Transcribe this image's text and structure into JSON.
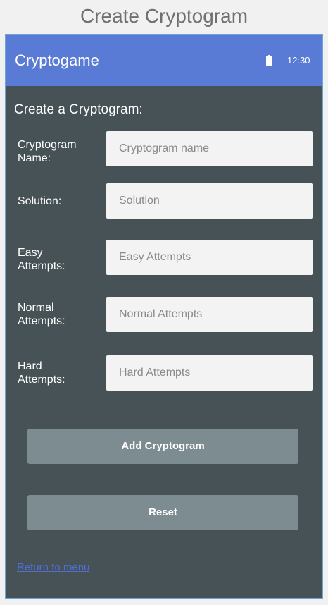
{
  "page": {
    "title": "Create Cryptogram"
  },
  "app_bar": {
    "title": "Cryptogame",
    "time": "12:30",
    "battery_icon": "battery-icon"
  },
  "form": {
    "heading": "Create a Cryptogram:",
    "fields": [
      {
        "label": "Cryptogram\nName:",
        "placeholder": "Cryptogram name",
        "value": ""
      },
      {
        "label": "Solution:",
        "placeholder": "Solution",
        "value": ""
      },
      {
        "label": "Easy\nAttempts:",
        "placeholder": "Easy Attempts",
        "value": ""
      },
      {
        "label": "Normal\nAttempts:",
        "placeholder": "Normal Attempts",
        "value": ""
      },
      {
        "label": "Hard\nAttempts:",
        "placeholder": "Hard Attempts",
        "value": ""
      }
    ],
    "add_button": "Add Cryptogram",
    "reset_button": "Reset",
    "return_link": "Return to menu"
  },
  "colors": {
    "app_bar": "#5a7bd5",
    "background": "#465256",
    "button": "#7d8c90",
    "link": "#4f6fd6"
  }
}
